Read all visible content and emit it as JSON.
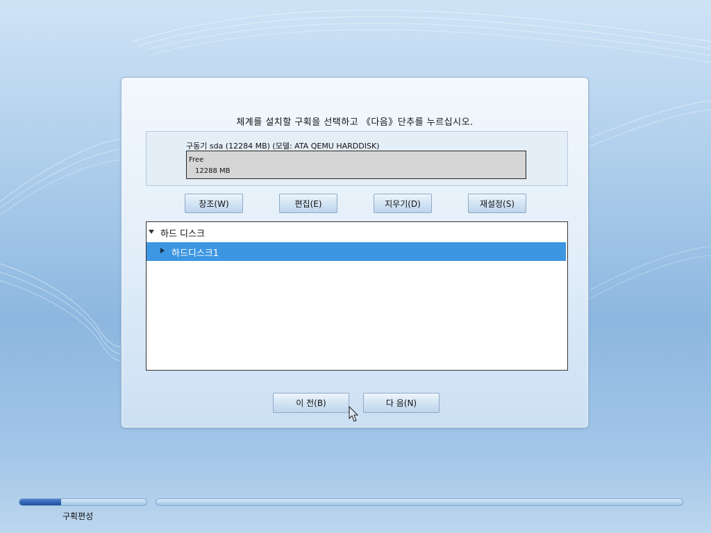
{
  "dialog": {
    "instruction": "체계를 설치할 구획을 선택하고 《다음》단추를 누르십시오.",
    "disk_title": "구동기 sda (12284 MB) (모델: ATA QEMU HARDDISK)",
    "partition": {
      "name": "Free",
      "size": "12288 MB"
    }
  },
  "actions": {
    "create": "창조(W)",
    "edit": "편집(E)",
    "delete": "지우기(D)",
    "reset": "재설정(S)"
  },
  "tree": {
    "root": "하드 디스크",
    "items": [
      "하드디스크1"
    ]
  },
  "nav": {
    "back": "이 전(B)",
    "next": "다 음(N)"
  },
  "footer": {
    "step_label": "구획편성",
    "step_progress_percent": 33
  },
  "colors": {
    "selection": "#3d96e2",
    "progress_fill": "#1e4f9e"
  }
}
